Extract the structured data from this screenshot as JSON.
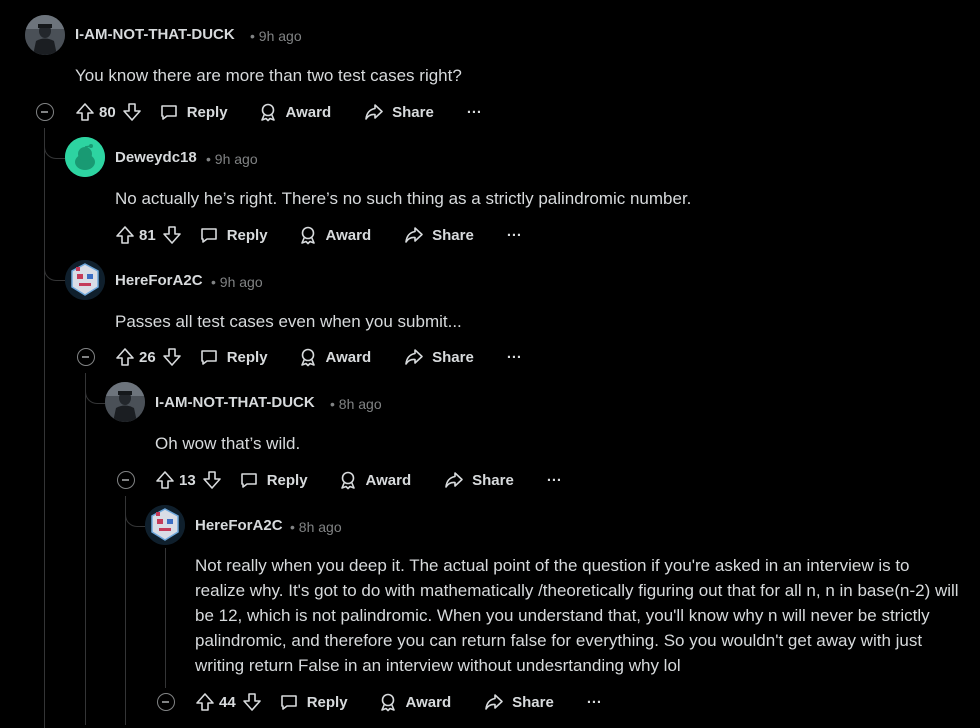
{
  "comments": [
    {
      "username": "I-AM-NOT-THAT-DUCK",
      "time": "• 9h ago",
      "body": "You know there are more than two test cases right?",
      "score": "80",
      "reply": "Reply",
      "award": "Award",
      "share": "Share",
      "more": "···"
    },
    {
      "username": "Deweydc18",
      "time": "• 9h ago",
      "body": "No actually he’s right. There’s no such thing as a strictly palindromic number.",
      "score": "81",
      "reply": "Reply",
      "award": "Award",
      "share": "Share",
      "more": "···"
    },
    {
      "username": "HereForA2C",
      "time": "• 9h ago",
      "body": "Passes all test cases even when you submit...",
      "score": "26",
      "reply": "Reply",
      "award": "Award",
      "share": "Share",
      "more": "···"
    },
    {
      "username": "I-AM-NOT-THAT-DUCK",
      "time": "• 8h ago",
      "body": "Oh wow that’s wild.",
      "score": "13",
      "reply": "Reply",
      "award": "Award",
      "share": "Share",
      "more": "···"
    },
    {
      "username": "HereForA2C",
      "time": "• 8h ago",
      "body": "Not really when you deep it. The actual point of the question if you're asked in an interview is to realize why. It's got to do with mathematically /theoretically figuring out that for all n, n in base(n-2) will be 12, which is not palindromic. When you understand that, you'll know why n will never be strictly palindromic, and therefore you can return false for everything. So you wouldn't get away with just writing return False in an interview without undesrtanding why lol",
      "score": "44",
      "reply": "Reply",
      "award": "Award",
      "share": "Share",
      "more": "···"
    }
  ],
  "colors": {
    "background": "#000000",
    "text": "#d7dadc",
    "meta": "#818384",
    "thread_line": "#343536",
    "snoo_green": "#2dd4a1"
  }
}
